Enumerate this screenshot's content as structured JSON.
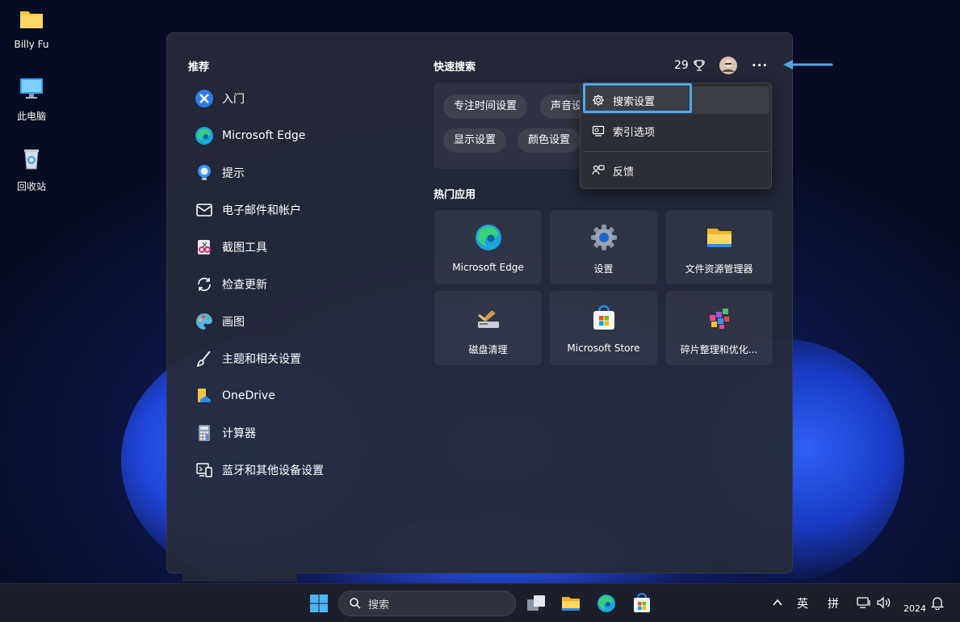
{
  "desktop": {
    "icons": [
      {
        "label": "Billy Fu"
      },
      {
        "label": "此电脑"
      },
      {
        "label": "回收站"
      }
    ]
  },
  "recommended": {
    "title": "推荐",
    "items": [
      {
        "label": "入门"
      },
      {
        "label": "Microsoft Edge"
      },
      {
        "label": "提示"
      },
      {
        "label": "电子邮件和帐户"
      },
      {
        "label": "截图工具"
      },
      {
        "label": "检查更新"
      },
      {
        "label": "画图"
      },
      {
        "label": "主题和相关设置"
      },
      {
        "label": "OneDrive"
      },
      {
        "label": "计算器"
      },
      {
        "label": "蓝牙和其他设备设置"
      }
    ]
  },
  "quick_search": {
    "title": "快速搜索",
    "chips": [
      {
        "label": "专注时间设置"
      },
      {
        "label": "声音设"
      },
      {
        "label": "显示设置"
      },
      {
        "label": "颜色设置"
      }
    ]
  },
  "header": {
    "points": "29",
    "more_label": "···"
  },
  "menu": {
    "items": [
      {
        "label": "搜索设置"
      },
      {
        "label": "索引选项"
      },
      {
        "label": "反馈"
      }
    ]
  },
  "top_apps": {
    "title": "热门应用",
    "tiles": [
      {
        "label": "Microsoft Edge"
      },
      {
        "label": "设置"
      },
      {
        "label": "文件资源管理器"
      },
      {
        "label": "磁盘清理"
      },
      {
        "label": "Microsoft Store"
      },
      {
        "label": "碎片整理和优化..."
      }
    ]
  },
  "taskbar": {
    "search_placeholder": "搜索",
    "ime_lang": "英",
    "ime_mode": "拼",
    "clock": "2024"
  },
  "colors": {
    "accent": "#4fa8e8",
    "panel": "#262a38"
  }
}
